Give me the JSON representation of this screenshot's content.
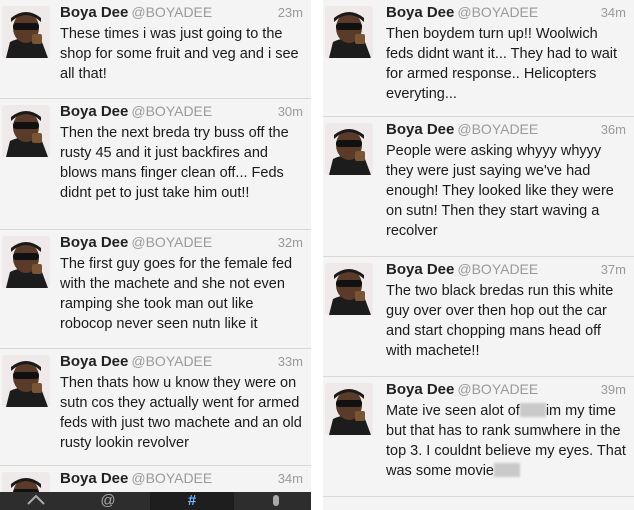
{
  "user": {
    "name": "Boya Dee",
    "handle": "@BOYADEE"
  },
  "left_tweets": [
    {
      "time": "23m",
      "text": "These times i was just going to the shop for some fruit and veg and i see all that!"
    },
    {
      "time": "30m",
      "text": "Then the next breda try buss off the rusty 45 and it just backfires and blows mans finger clean off... Feds didnt pet to just take him out!!"
    },
    {
      "time": "32m",
      "text": "The first guy goes for the female fed with the machete and she not even ramping she took man out like robocop never seen nutn like it"
    },
    {
      "time": "33m",
      "text": "Then thats how u know they were on sutn cos they actually went for armed feds with just two machete and an old rusty lookin revolver"
    },
    {
      "time": "34m",
      "text": ""
    }
  ],
  "right_tweets": [
    {
      "time": "34m",
      "text": "Then boydem turn up!! Woolwich feds didnt want it... They had to wait for armed response.. Helicopters everyting..."
    },
    {
      "time": "36m",
      "text": "People were asking whyyy whyyy they were just saying we've had enough! They looked like they were on sutn! Then they start waving a recolver"
    },
    {
      "time": "37m",
      "text": "The two black bredas run this white guy over over then hop out the car and start chopping mans head off with machete!!"
    },
    {
      "time": "39m",
      "text_a": "Mate ive seen alot of",
      "text_b": "im my time but that has to rank sumwhere in the top 3. I couldnt believe my eyes. That was some movie"
    }
  ],
  "tabbar": {
    "tabs": [
      "home-icon",
      "mentions-icon",
      "search-icon",
      "me-icon"
    ],
    "active": 2,
    "mentions_glyph": "@",
    "search_glyph": "#"
  },
  "colors": {
    "name": "#222222",
    "meta": "#9a9a9a",
    "background": "#f4f4f4",
    "divider": "#d8d8d8"
  }
}
